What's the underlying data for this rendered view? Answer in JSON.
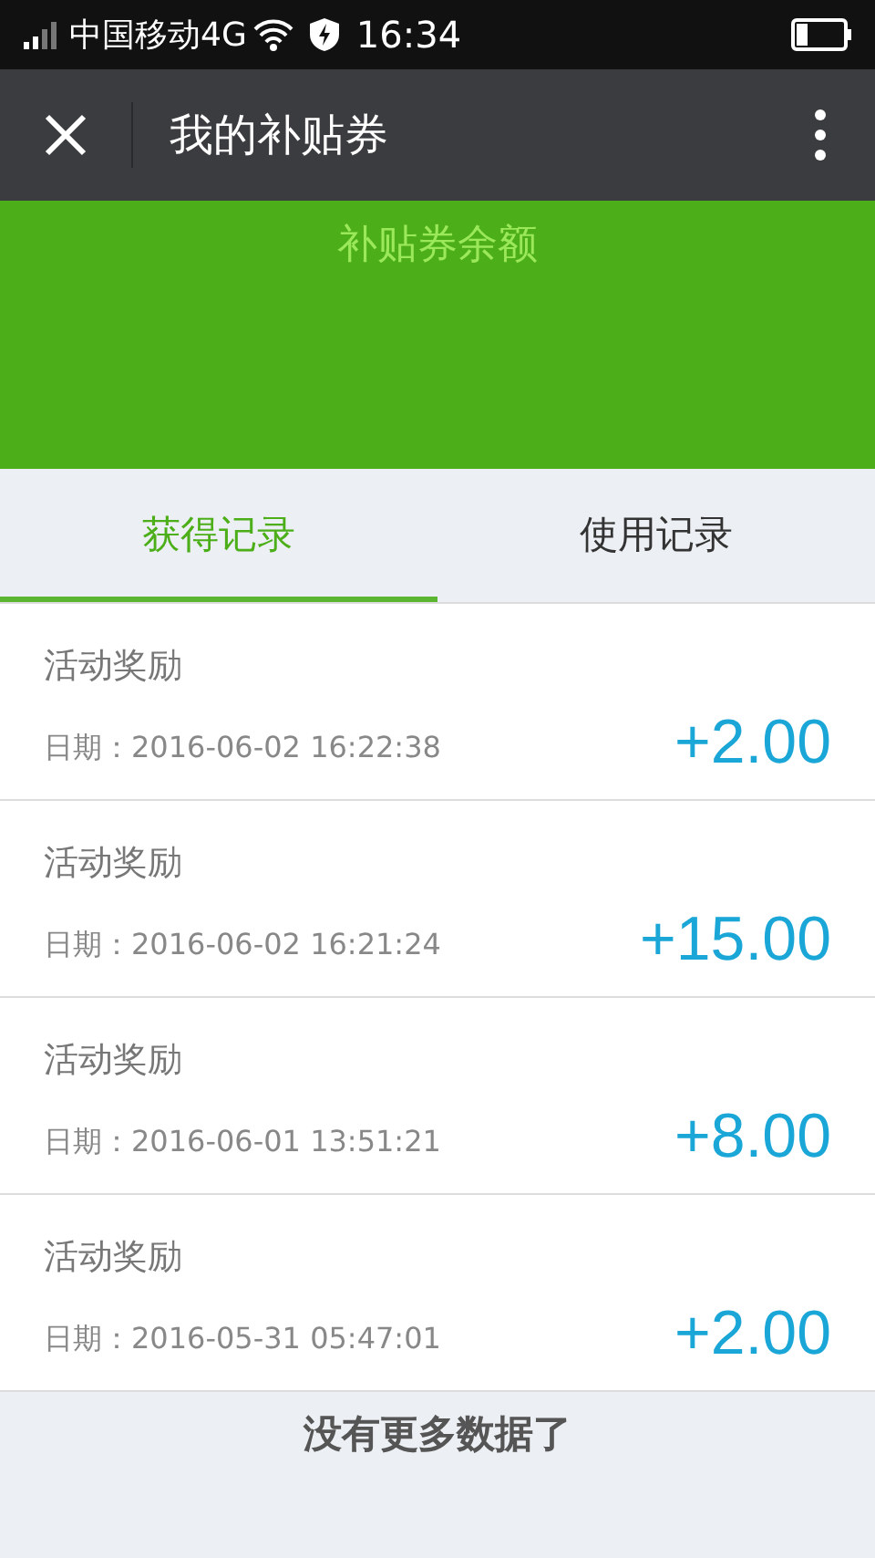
{
  "status_bar": {
    "carrier": "中国移动4G",
    "time": "16:34"
  },
  "nav": {
    "title": "我的补贴券"
  },
  "balance": {
    "label": "补贴券余额"
  },
  "tabs": [
    {
      "label": "获得记录",
      "selected": true
    },
    {
      "label": "使用记录",
      "selected": false
    }
  ],
  "records": [
    {
      "title": "活动奖励",
      "date": "日期：2016-06-02 16:22:38",
      "amount": "+2.00"
    },
    {
      "title": "活动奖励",
      "date": "日期：2016-06-02 16:21:24",
      "amount": "+15.00"
    },
    {
      "title": "活动奖励",
      "date": "日期：2016-06-01 13:51:21",
      "amount": "+8.00"
    },
    {
      "title": "活动奖励",
      "date": "日期：2016-05-31 05:47:01",
      "amount": "+2.00"
    }
  ],
  "footer": "没有更多数据了"
}
